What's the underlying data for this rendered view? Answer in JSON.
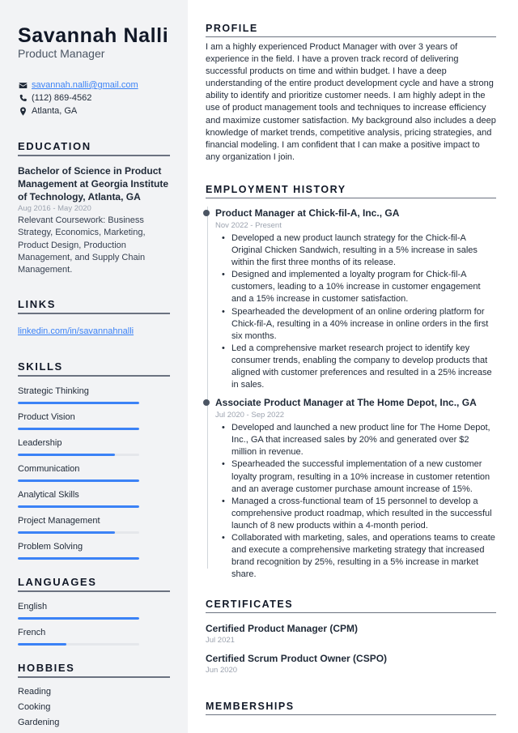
{
  "header": {
    "name": "Savannah Nalli",
    "title": "Product Manager"
  },
  "contact": {
    "email": "savannah.nalli@gmail.com",
    "phone": "(112) 869-4562",
    "location": "Atlanta, GA",
    "icons": {
      "email": "envelope-icon",
      "phone": "phone-icon",
      "location": "map-pin-icon"
    }
  },
  "education": {
    "heading": "EDUCATION",
    "degree": "Bachelor of Science in Product Management at Georgia Institute of Technology, Atlanta, GA",
    "dates": "Aug 2016 - May 2020",
    "coursework": "Relevant Coursework: Business Strategy, Economics, Marketing, Product Design, Production Management, and Supply Chain Management."
  },
  "links": {
    "heading": "LINKS",
    "items": [
      {
        "label": "linkedin.com/in/savannahnalli"
      }
    ]
  },
  "skills": {
    "heading": "SKILLS",
    "items": [
      {
        "label": "Strategic Thinking",
        "level": 1.0
      },
      {
        "label": "Product Vision",
        "level": 1.0
      },
      {
        "label": "Leadership",
        "level": 0.8
      },
      {
        "label": "Communication",
        "level": 1.0
      },
      {
        "label": "Analytical Skills",
        "level": 1.0
      },
      {
        "label": "Project Management",
        "level": 0.8
      },
      {
        "label": "Problem Solving",
        "level": 1.0
      }
    ]
  },
  "languages": {
    "heading": "LANGUAGES",
    "items": [
      {
        "label": "English",
        "level": 1.0
      },
      {
        "label": "French",
        "level": 0.4
      }
    ]
  },
  "hobbies": {
    "heading": "HOBBIES",
    "items": [
      "Reading",
      "Cooking",
      "Gardening"
    ]
  },
  "profile": {
    "heading": "PROFILE",
    "text": "I am a highly experienced Product Manager with over 3 years of experience in the field. I have a proven track record of delivering successful products on time and within budget. I have a deep understanding of the entire product development cycle and have a strong ability to identify and prioritize customer needs. I am highly adept in the use of product management tools and techniques to increase efficiency and maximize customer satisfaction. My background also includes a deep knowledge of market trends, competitive analysis, pricing strategies, and financial modeling. I am confident that I can make a positive impact to any organization I join."
  },
  "employment": {
    "heading": "EMPLOYMENT HISTORY",
    "jobs": [
      {
        "title": "Product Manager at Chick-fil-A, Inc., GA",
        "dates": "Nov 2022 - Present",
        "bullets": [
          "Developed a new product launch strategy for the Chick-fil-A Original Chicken Sandwich, resulting in a 5% increase in sales within the first three months of its release.",
          "Designed and implemented a loyalty program for Chick-fil-A customers, leading to a 10% increase in customer engagement and a 15% increase in customer satisfaction.",
          "Spearheaded the development of an online ordering platform for Chick-fil-A, resulting in a 40% increase in online orders in the first six months.",
          "Led a comprehensive market research project to identify key consumer trends, enabling the company to develop products that aligned with customer preferences and resulted in a 25% increase in sales."
        ]
      },
      {
        "title": "Associate Product Manager at The Home Depot, Inc., GA",
        "dates": "Jul 2020 - Sep 2022",
        "bullets": [
          "Developed and launched a new product line for The Home Depot, Inc., GA that increased sales by 20% and generated over $2 million in revenue.",
          "Spearheaded the successful implementation of a new customer loyalty program, resulting in a 10% increase in customer retention and an average customer purchase amount increase of 15%.",
          "Managed a cross-functional team of 15 personnel to develop a comprehensive product roadmap, which resulted in the successful launch of 8 new products within a 4-month period.",
          "Collaborated with marketing, sales, and operations teams to create and execute a comprehensive marketing strategy that increased brand recognition by 25%, resulting in a 5% increase in market share."
        ]
      }
    ]
  },
  "certificates": {
    "heading": "CERTIFICATES",
    "items": [
      {
        "title": "Certified Product Manager (CPM)",
        "date": "Jul 2021"
      },
      {
        "title": "Certified Scrum Product Owner (CSPO)",
        "date": "Jun 2020"
      }
    ]
  },
  "memberships": {
    "heading": "MEMBERSHIPS"
  },
  "colors": {
    "accent": "#3b82f6",
    "sidebar_bg": "#f2f3f5",
    "text": "#1f2937",
    "muted": "#9ca3af",
    "rule": "#6b7280"
  }
}
